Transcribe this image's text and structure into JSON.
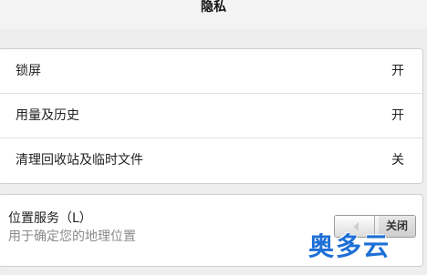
{
  "header": {
    "title": "隐私"
  },
  "privacy_items": [
    {
      "label": "锁屏",
      "value": "开"
    },
    {
      "label": "用量及历史",
      "value": "开"
    },
    {
      "label": "清理回收站及临时文件",
      "value": "关"
    }
  ],
  "location": {
    "title": "位置服务（L）",
    "subtitle": "用于确定您的地理位置",
    "toggle_label": "关闭",
    "enabled": false
  },
  "watermark": {
    "text": "奥多云"
  }
}
